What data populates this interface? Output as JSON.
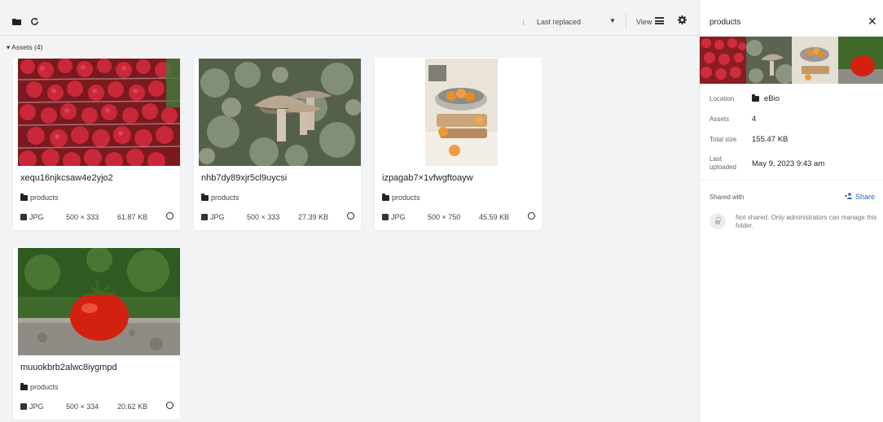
{
  "toolbar": {
    "folder_icon": "folder-icon",
    "refresh_icon": "refresh-icon",
    "sort_arrow": "↓",
    "sort_label": "Last replaced",
    "view_label": "View",
    "settings_icon": "gear-icon"
  },
  "assets_header": "▾ Assets (4)",
  "cards": [
    {
      "name": "xequ16njkcsaw4e2yjo2",
      "folder": "products",
      "type": "JPG",
      "dimensions": "500 × 333",
      "size": "61.87 KB"
    },
    {
      "name": "nhb7dy89xjr5cl9uycsi",
      "folder": "products",
      "type": "JPG",
      "dimensions": "500 × 333",
      "size": "27.39 KB"
    },
    {
      "name": "izpagab7×1vfwgftoayw",
      "folder": "products",
      "type": "JPG",
      "dimensions": "500 × 750",
      "size": "45.59 KB"
    },
    {
      "name": "muuokbrb2alwc8iygmpd",
      "folder": "products",
      "type": "JPG",
      "dimensions": "500 × 334",
      "size": "20.62 KB"
    }
  ],
  "panel": {
    "title": "products",
    "close": "✕",
    "location_label": "Location",
    "location_value": "eBio",
    "assets_label": "Assets",
    "assets_value": "4",
    "total_size_label": "Total size",
    "total_size_value": "155.47 KB",
    "last_uploaded_label_1": "Last",
    "last_uploaded_label_2": "uploaded",
    "last_uploaded_value": "May 9, 2023 9:43 am",
    "shared_with_label": "Shared with",
    "share_label": "Share",
    "not_shared_text": "Not shared. Only administrators can manage this folder."
  },
  "colors": {
    "accent": "#2563c9",
    "background": "#f2f3f5"
  }
}
